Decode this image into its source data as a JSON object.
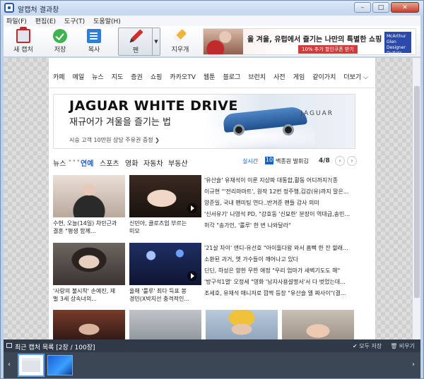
{
  "window": {
    "title": "알캡처 결과창",
    "buttons": {
      "minimize": "–",
      "maximize": "□",
      "close": "✕"
    }
  },
  "menu": [
    "파일(F)",
    "편집(E)",
    "도구(T)",
    "도움말(H)"
  ],
  "toolbar": {
    "new_capture": "새 캡처",
    "save": "저장",
    "copy": "복사",
    "pen": "펜",
    "eraser": "지우개",
    "ad": {
      "text": "올 겨울, 유럽에서 즐기는 나만의 특별한 쇼핑 경험",
      "button": "10% 추가 할인쿠폰 받기",
      "logo": "McArthur Glen Designer Outlets"
    }
  },
  "webpage": {
    "nav": [
      "카페",
      "메일",
      "뉴스",
      "지도",
      "증권",
      "쇼핑",
      "카카오TV",
      "웹툰",
      "블로그",
      "브런치",
      "사전",
      "게임",
      "같이가치",
      "더보기 ⌵"
    ],
    "banner": {
      "title": "JAGUAR WHITE DRIVE",
      "subtitle": "재규어가 겨울을 즐기는 법",
      "cta": "시승 고객 10만원 상당 주유권 증정 ❯",
      "brand": "JAGUAR"
    },
    "news_tabs": {
      "news": "뉴스",
      "dots": "•••",
      "entertainment": "연예",
      "sports": "스포츠",
      "movies": "영화",
      "autos": "자동차",
      "realestate": "부동산"
    },
    "realtime": {
      "label": "실시간",
      "rank": "10",
      "keyword": "백종원 발휘김"
    },
    "pager": {
      "current": "4/8",
      "prev": "‹",
      "next": "›"
    },
    "cards": [
      {
        "caption_1": "수현, 오늘(14일) 차민근과",
        "caption_2": "결혼 \"평생 함께..."
      },
      {
        "caption_1": "신민아, 클로즈업 부르는",
        "caption_2": "미모"
      },
      {
        "caption_1": "'사랑의 불시착' 손예진, 재",
        "caption_2": "벌 3세 상속녀의..."
      },
      {
        "caption_1": "올해 '룰루' 최다 득표 봉",
        "caption_2": "경민(X박지선 충격적인..."
      }
    ],
    "headlines_top": [
      "'유산슬' 유재석이 이룬 지상파 대통합,활동 어디까지?(종",
      "이규현 \"'전리마마트', 원작 12번 정주행,김강(유)까지 말은...",
      "양준일, 국내 팬미팅 연다..반겨준 팬들 감사 의미",
      "'신서유기' 나영석 PD, \"강호동 '신묘한' 분장이 역대급,송민...",
      "허각 \"송가인, '룰루' 한 번 나와달라\""
    ],
    "headlines_bottom": [
      "'21살 차이' 앤디-유선호 \"아이돌다왕 와서 흠뻑 한 잔 할래...",
      "소환된 과거, 옛 가수들이 깨어나고 있다",
      "딘딘, 하성은 향한 무한 애정 \"우리 엄마가 새벽기도도 해\"",
      "'방구석1열' 오정세 \"영화 '남자사용설명서'서 다 벗었는데...",
      "조세호, 유재석 매니저로 깜짝 등장 \"유산슬 엘 짜사이\"(결..."
    ]
  },
  "recent": {
    "title": "최근 캡처 목록 [2장 / 100장]",
    "save_all": "✔ 모두 저장",
    "clear": "🗑 비우기",
    "prev": "‹",
    "next": "›"
  }
}
